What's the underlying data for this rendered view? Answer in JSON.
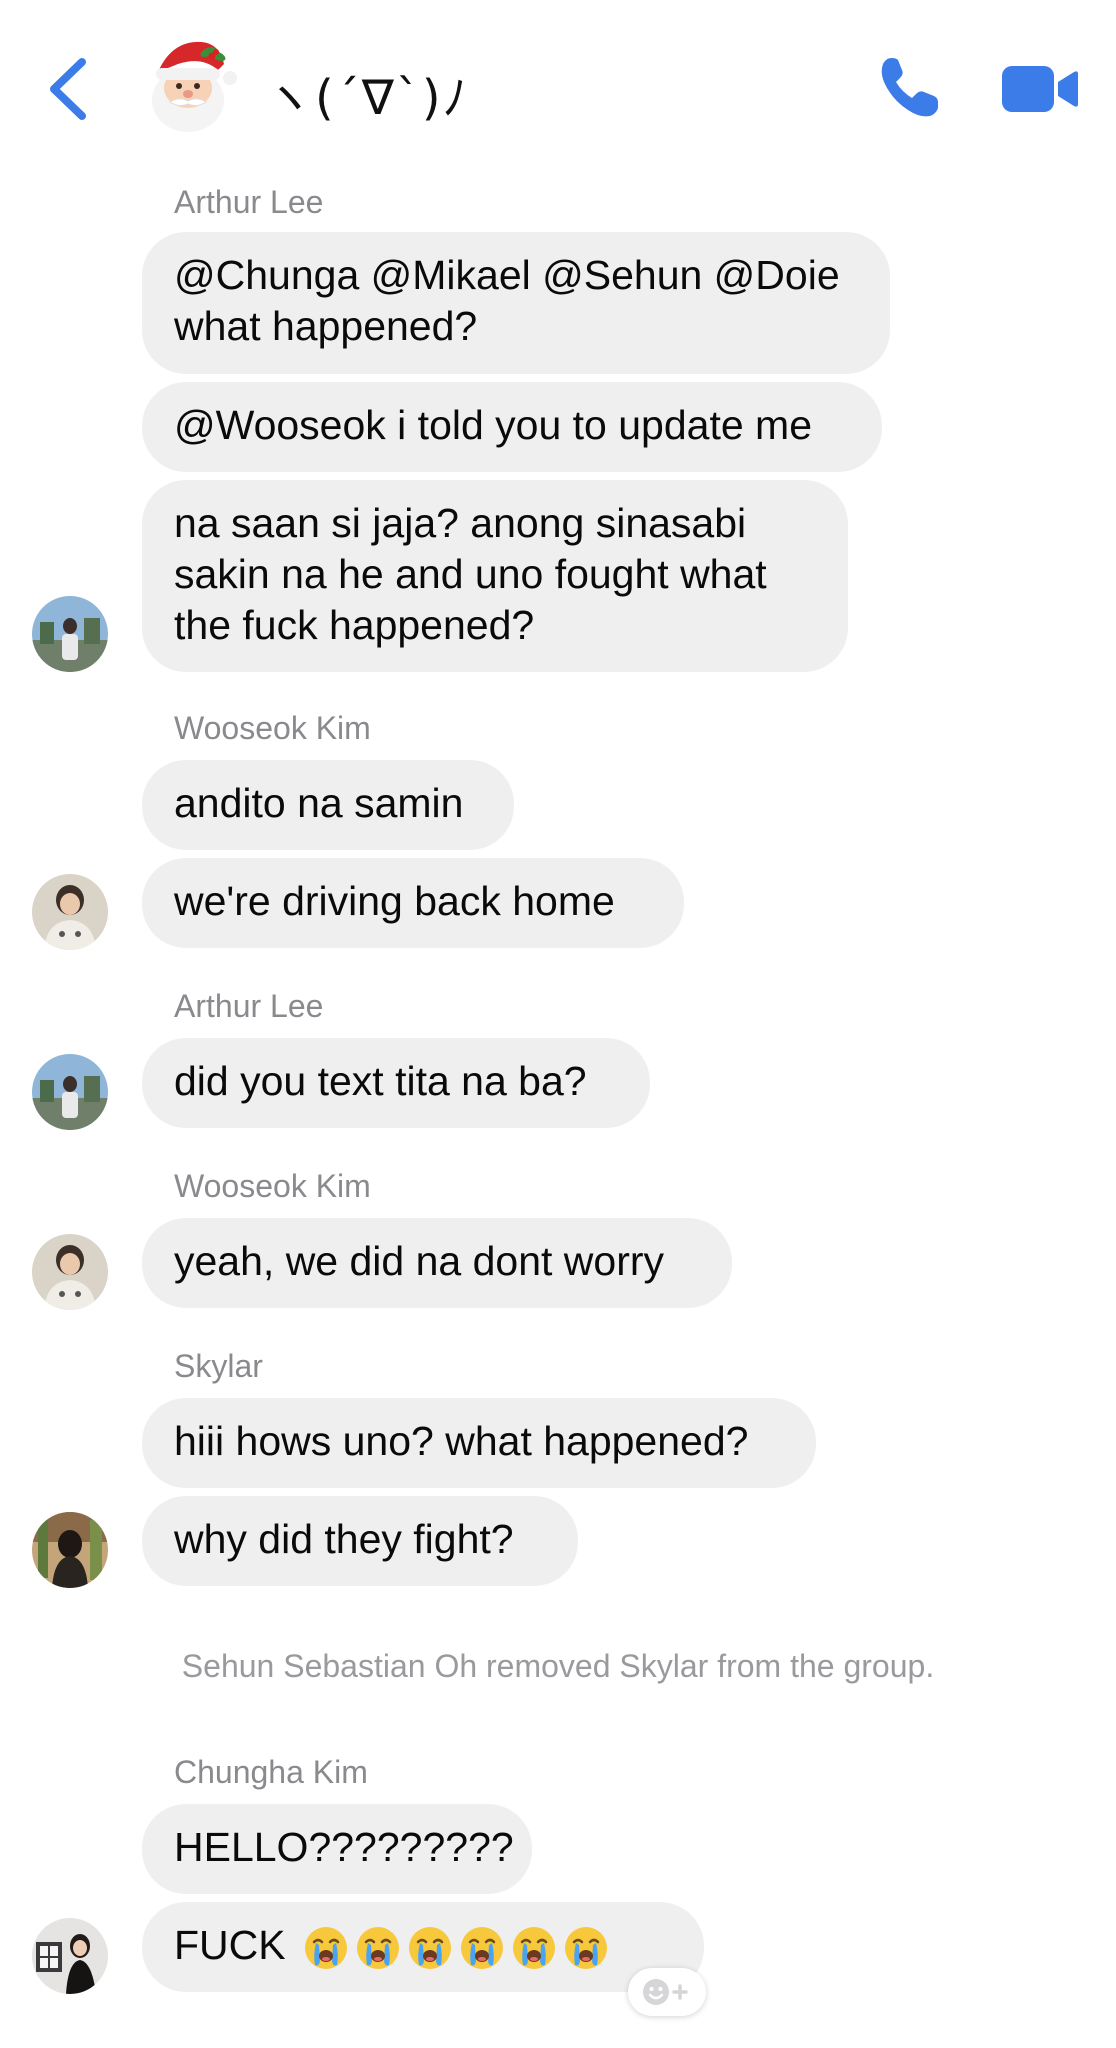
{
  "header": {
    "title": "ヽ(´∇`)ﾉ",
    "accent_color": "#3b7ce8",
    "icons": {
      "back": "chevron-left-icon",
      "call": "phone-icon",
      "video": "video-camera-icon",
      "group_avatar": "santa-emoji-icon"
    }
  },
  "groups": [
    {
      "sender": "Arthur Lee",
      "messages": [
        "@Chunga @Mikael @Sehun @Doie",
        "what happened?",
        "@Wooseok i told you to update me",
        "na saan si jaja? anong sinasabi",
        "sakin na he and uno fought what",
        "the fuck happened?"
      ]
    },
    {
      "sender": "Wooseok Kim",
      "messages": [
        "andito na samin",
        "we're driving back home"
      ]
    },
    {
      "sender": "Arthur Lee",
      "messages": [
        "did you text tita na ba?"
      ]
    },
    {
      "sender": "Wooseok Kim",
      "messages": [
        "yeah, we did na dont worry"
      ]
    },
    {
      "sender": "Skylar",
      "messages": [
        "hiii hows uno? what happened?",
        "why did they fight?"
      ]
    }
  ],
  "system_message": "Sehun Sebastian Oh removed Skylar from the group.",
  "last_group": {
    "sender": "Chungha Kim",
    "messages": [
      "HELLO?????????",
      "FUCK"
    ],
    "emoji_count": 6,
    "emoji_name": "loudly-crying-face-icon"
  },
  "reaction_button": {
    "icon": "smiley-add-icon"
  },
  "colors": {
    "bubble": "#efeff0",
    "sender_name": "#8a8a8e",
    "system_text": "#9a9a9e"
  }
}
